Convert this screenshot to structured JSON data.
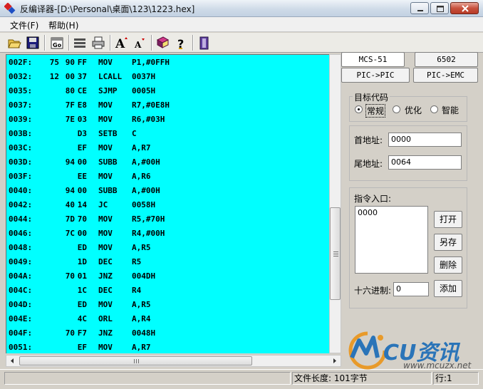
{
  "window": {
    "title": "反编译器-[D:\\Personal\\桌面\\123\\1223.hex]"
  },
  "menu": [
    {
      "label": "文件(F)"
    },
    {
      "label": "帮助(H)"
    }
  ],
  "toolbar": {
    "buttons": [
      {
        "icon": "open-folder-icon"
      },
      {
        "icon": "save-disk-icon"
      },
      {
        "icon": "go-icon",
        "label": "Go"
      },
      {
        "icon": "list-icon"
      },
      {
        "icon": "printer-icon"
      },
      {
        "icon": "font-increase-icon",
        "label": "A"
      },
      {
        "icon": "font-decrease-icon",
        "label": "A"
      },
      {
        "icon": "book-icon"
      },
      {
        "icon": "help-icon",
        "label": "?"
      },
      {
        "icon": "exit-icon"
      }
    ]
  },
  "listing": {
    "background": "#00ffff",
    "rows": [
      {
        "addr": "002F:",
        "b1": "75",
        "b2": "90",
        "b3": "FF",
        "mnem": "MOV",
        "ops": "P1,#0FFH"
      },
      {
        "addr": "0032:",
        "b1": "12",
        "b2": "00",
        "b3": "37",
        "mnem": "LCALL",
        "ops": "0037H"
      },
      {
        "addr": "0035:",
        "b1": "",
        "b2": "80",
        "b3": "CE",
        "mnem": "SJMP",
        "ops": "0005H"
      },
      {
        "addr": "0037:",
        "b1": "",
        "b2": "7F",
        "b3": "E8",
        "mnem": "MOV",
        "ops": "R7,#0E8H"
      },
      {
        "addr": "0039:",
        "b1": "",
        "b2": "7E",
        "b3": "03",
        "mnem": "MOV",
        "ops": "R6,#03H"
      },
      {
        "addr": "003B:",
        "b1": "",
        "b2": "",
        "b3": "D3",
        "mnem": "SETB",
        "ops": "C"
      },
      {
        "addr": "003C:",
        "b1": "",
        "b2": "",
        "b3": "EF",
        "mnem": "MOV",
        "ops": "A,R7"
      },
      {
        "addr": "003D:",
        "b1": "",
        "b2": "94",
        "b3": "00",
        "mnem": "SUBB",
        "ops": "A,#00H"
      },
      {
        "addr": "003F:",
        "b1": "",
        "b2": "",
        "b3": "EE",
        "mnem": "MOV",
        "ops": "A,R6"
      },
      {
        "addr": "0040:",
        "b1": "",
        "b2": "94",
        "b3": "00",
        "mnem": "SUBB",
        "ops": "A,#00H"
      },
      {
        "addr": "0042:",
        "b1": "",
        "b2": "40",
        "b3": "14",
        "mnem": "JC",
        "ops": "0058H"
      },
      {
        "addr": "0044:",
        "b1": "",
        "b2": "7D",
        "b3": "70",
        "mnem": "MOV",
        "ops": "R5,#70H"
      },
      {
        "addr": "0046:",
        "b1": "",
        "b2": "7C",
        "b3": "00",
        "mnem": "MOV",
        "ops": "R4,#00H"
      },
      {
        "addr": "0048:",
        "b1": "",
        "b2": "",
        "b3": "ED",
        "mnem": "MOV",
        "ops": "A,R5"
      },
      {
        "addr": "0049:",
        "b1": "",
        "b2": "",
        "b3": "1D",
        "mnem": "DEC",
        "ops": "R5"
      },
      {
        "addr": "004A:",
        "b1": "",
        "b2": "70",
        "b3": "01",
        "mnem": "JNZ",
        "ops": "004DH"
      },
      {
        "addr": "004C:",
        "b1": "",
        "b2": "",
        "b3": "1C",
        "mnem": "DEC",
        "ops": "R4"
      },
      {
        "addr": "004D:",
        "b1": "",
        "b2": "",
        "b3": "ED",
        "mnem": "MOV",
        "ops": "A,R5"
      },
      {
        "addr": "004E:",
        "b1": "",
        "b2": "",
        "b3": "4C",
        "mnem": "ORL",
        "ops": "A,R4"
      },
      {
        "addr": "004F:",
        "b1": "",
        "b2": "70",
        "b3": "F7",
        "mnem": "JNZ",
        "ops": "0048H"
      },
      {
        "addr": "0051:",
        "b1": "",
        "b2": "",
        "b3": "EF",
        "mnem": "MOV",
        "ops": "A,R7"
      }
    ]
  },
  "cpu_tabs": [
    {
      "label": "MCS-51",
      "selected": true
    },
    {
      "label": "6502",
      "selected": false
    },
    {
      "label": "PIC->PIC",
      "selected": false
    },
    {
      "label": "PIC->EMC",
      "selected": false
    }
  ],
  "target_code": {
    "title": "目标代码",
    "options": [
      {
        "label": "常规",
        "checked": true
      },
      {
        "label": "优化",
        "checked": false
      },
      {
        "label": "智能",
        "checked": false
      }
    ]
  },
  "address": {
    "start_label": "首地址:",
    "start_value": "0000",
    "end_label": "尾地址:",
    "end_value": "0064"
  },
  "entry": {
    "title": "指令入口:",
    "items": [
      "0000"
    ],
    "buttons": [
      "打开",
      "另存",
      "删除",
      "添加"
    ],
    "hex_label": "十六进制:",
    "hex_value": "0"
  },
  "status": {
    "file_length": "文件长度: 101字节",
    "line": "行:1"
  },
  "watermark": {
    "brand": "CU资讯",
    "url": "www.mcuzx.net"
  }
}
